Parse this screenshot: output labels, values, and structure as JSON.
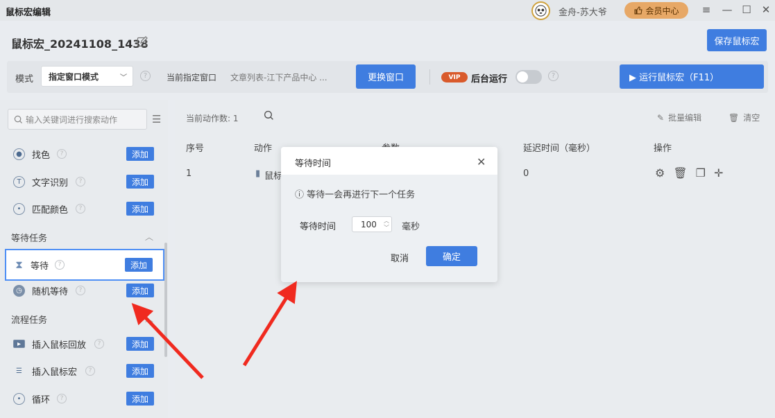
{
  "window": {
    "title": "鼠标宏编辑",
    "user": "金舟-苏大爷",
    "vip_button": "会员中心"
  },
  "macro": {
    "name": "鼠标宏_20241108_1438",
    "save_label": "保存鼠标宏"
  },
  "mode_bar": {
    "mode_label": "模式",
    "mode_value": "指定窗口模式",
    "current_window_label": "当前指定窗口",
    "current_window_value": "文章列表-江下产品中心 ...",
    "change_button": "更换窗口",
    "vip_badge": "VIP",
    "background_run_label": "后台运行",
    "run_button": "▶ 运行鼠标宏（F11）"
  },
  "sidebar": {
    "search_placeholder": "输入关键词进行搜索动作",
    "add_label": "添加",
    "items_top": [
      {
        "label": "找色"
      },
      {
        "label": "文字识别"
      },
      {
        "label": "匹配颜色"
      }
    ],
    "section_wait": "等待任务",
    "items_wait": [
      {
        "label": "等待"
      },
      {
        "label": "随机等待"
      }
    ],
    "section_flow": "流程任务",
    "items_flow": [
      {
        "label": "插入鼠标回放"
      },
      {
        "label": "插入鼠标宏"
      },
      {
        "label": "循环"
      }
    ]
  },
  "main": {
    "count_label": "当前动作数:",
    "count_value": "1",
    "batch_edit": "批量编辑",
    "clear": "清空",
    "headers": [
      "序号",
      "动作",
      "参数",
      "延迟时间（毫秒）",
      "操作"
    ],
    "rows": [
      {
        "index": "1",
        "action": "鼠标",
        "delay": "0"
      }
    ]
  },
  "dialog": {
    "title": "等待时间",
    "info": "等待一会再进行下一个任务",
    "wait_label": "等待时间",
    "wait_value": "100",
    "unit": "毫秒",
    "cancel": "取消",
    "ok": "确定"
  },
  "colors": {
    "accent": "#3f7de0",
    "arrow": "#f02a1f"
  }
}
